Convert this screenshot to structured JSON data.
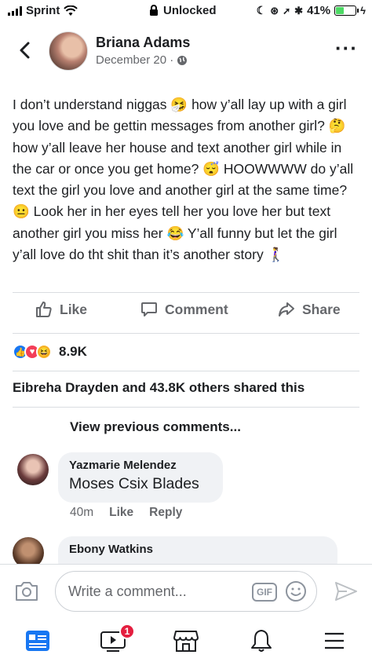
{
  "status_bar": {
    "carrier": "Sprint",
    "center": "Unlocked",
    "battery": "41%",
    "battery_level": 0.41
  },
  "post": {
    "author": "Briana Adams",
    "date": "December 20 ·",
    "text_parts": [
      "I don’t understand niggas ",
      " how y’all lay up with a girl you love and be gettin messages from another girl? ",
      " how y’all leave her house and text another girl while in the car or once you get home? ",
      " HOOWWWW do y’all text the girl you love and another girl at the same time? ",
      " Look her in her eyes tell her you love her but text another girl you miss her ",
      " Y’all funny but let the girl y’all love do tht shit than it’s another story "
    ],
    "emojis": [
      "🤧",
      "🤔",
      "😴",
      "😐",
      "😂",
      "🚶‍♀️"
    ]
  },
  "actions": {
    "like": "Like",
    "comment": "Comment",
    "share": "Share"
  },
  "reactions": {
    "count": "8.9K",
    "icons": [
      "like-icon",
      "love-icon",
      "haha-icon"
    ]
  },
  "shared_text": "Eibreha Drayden and 43.8K others shared this",
  "view_previous": "View previous comments...",
  "comments": [
    {
      "name": "Yazmarie Melendez",
      "text": "Moses Csix Blades",
      "time": "40m",
      "like": "Like",
      "reply": "Reply"
    },
    {
      "name": "Ebony Watkins",
      "text": ""
    }
  ],
  "compose": {
    "placeholder": "Write a comment...",
    "gif_label": "GIF"
  },
  "bottom_nav": {
    "video_badge": "1"
  },
  "colors": {
    "accent": "#1877f2",
    "muted": "#65676b",
    "bubble": "#f0f2f5",
    "badge": "#e41e3f"
  }
}
